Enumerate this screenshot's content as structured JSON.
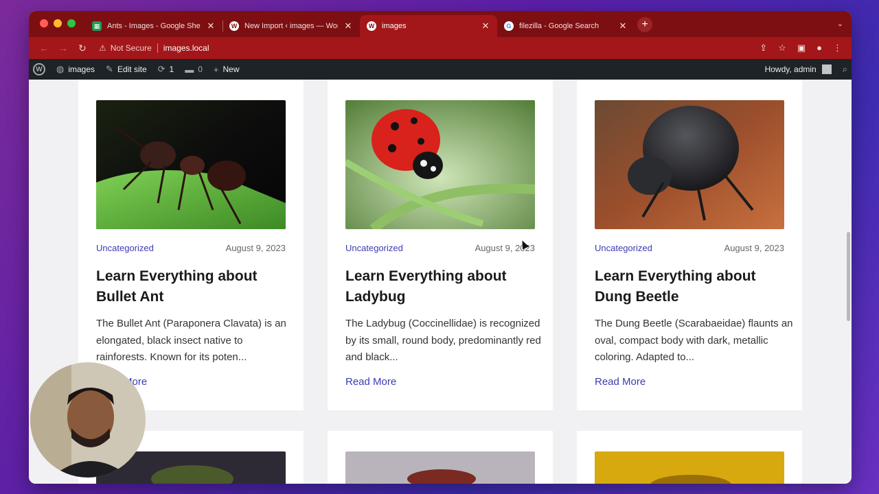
{
  "tabs": [
    {
      "title": "Ants - Images - Google Sheets",
      "favicon": "sheets-icon"
    },
    {
      "title": "New Import ‹ images — WordPress",
      "favicon": "wordpress-icon"
    },
    {
      "title": "images",
      "favicon": "wordpress-icon",
      "active": true
    },
    {
      "title": "filezilla - Google Search",
      "favicon": "google-icon"
    }
  ],
  "toolbar": {
    "security_label": "Not Secure",
    "url": "images.local"
  },
  "adminbar": {
    "site_name": "images",
    "edit_site": "Edit site",
    "updates_count": "1",
    "comments_count": "0",
    "new_label": "New",
    "howdy": "Howdy, admin"
  },
  "posts": [
    {
      "category": "Uncategorized",
      "date": "August 9, 2023",
      "title": "Learn Everything about Bullet Ant",
      "excerpt": "The Bullet Ant (Paraponera Clavata) is an elongated, black insect native to rainforests. Known for its poten...",
      "read_more": "Read More"
    },
    {
      "category": "Uncategorized",
      "date": "August 9, 2023",
      "title": "Learn Everything about Ladybug",
      "excerpt": "The Ladybug (Coccinellidae) is recognized by its small, round body, predominantly red and black...",
      "read_more": "Read More"
    },
    {
      "category": "Uncategorized",
      "date": "August 9, 2023",
      "title": "Learn Everything about Dung Beetle",
      "excerpt": "The Dung Beetle (Scarabaeidae) flaunts an oval, compact body with dark, metallic coloring. Adapted to...",
      "read_more": "Read More"
    }
  ],
  "colors": {
    "browser_frame": "#7d0f12",
    "active_tab": "#a31619",
    "wp_adminbar": "#1d2327",
    "link": "#3b3bb3"
  }
}
